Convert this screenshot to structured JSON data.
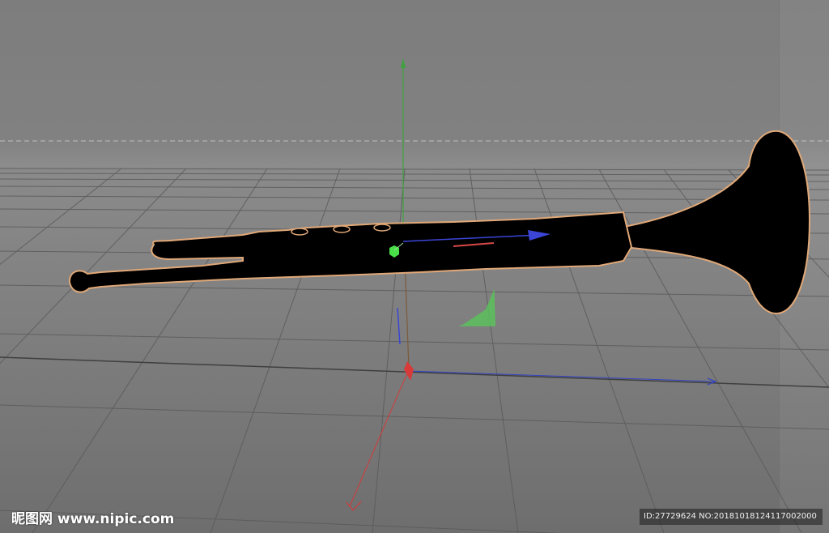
{
  "viewport": {
    "scene_object": "trumpet",
    "colors": {
      "background": "#7d7d7d",
      "grid_line": "#5c5c5c",
      "object_fill": "#000000",
      "selection_outline": "#e0a878",
      "axis_x": "#d83a3a",
      "axis_y": "#3fbf3f",
      "axis_z": "#2f3fc8",
      "horizon": "#d0d0d0"
    },
    "icons": [
      "move-gizmo-icon",
      "axis-y-arrow-icon",
      "axis-x-arrow-icon",
      "axis-z-arrow-icon",
      "pivot-handle-icon",
      "plane-handle-icon"
    ]
  },
  "watermark": {
    "site": "昵图网 www.nipic.com",
    "id_text": "ID:27729624 NO:20181018124117002000"
  }
}
